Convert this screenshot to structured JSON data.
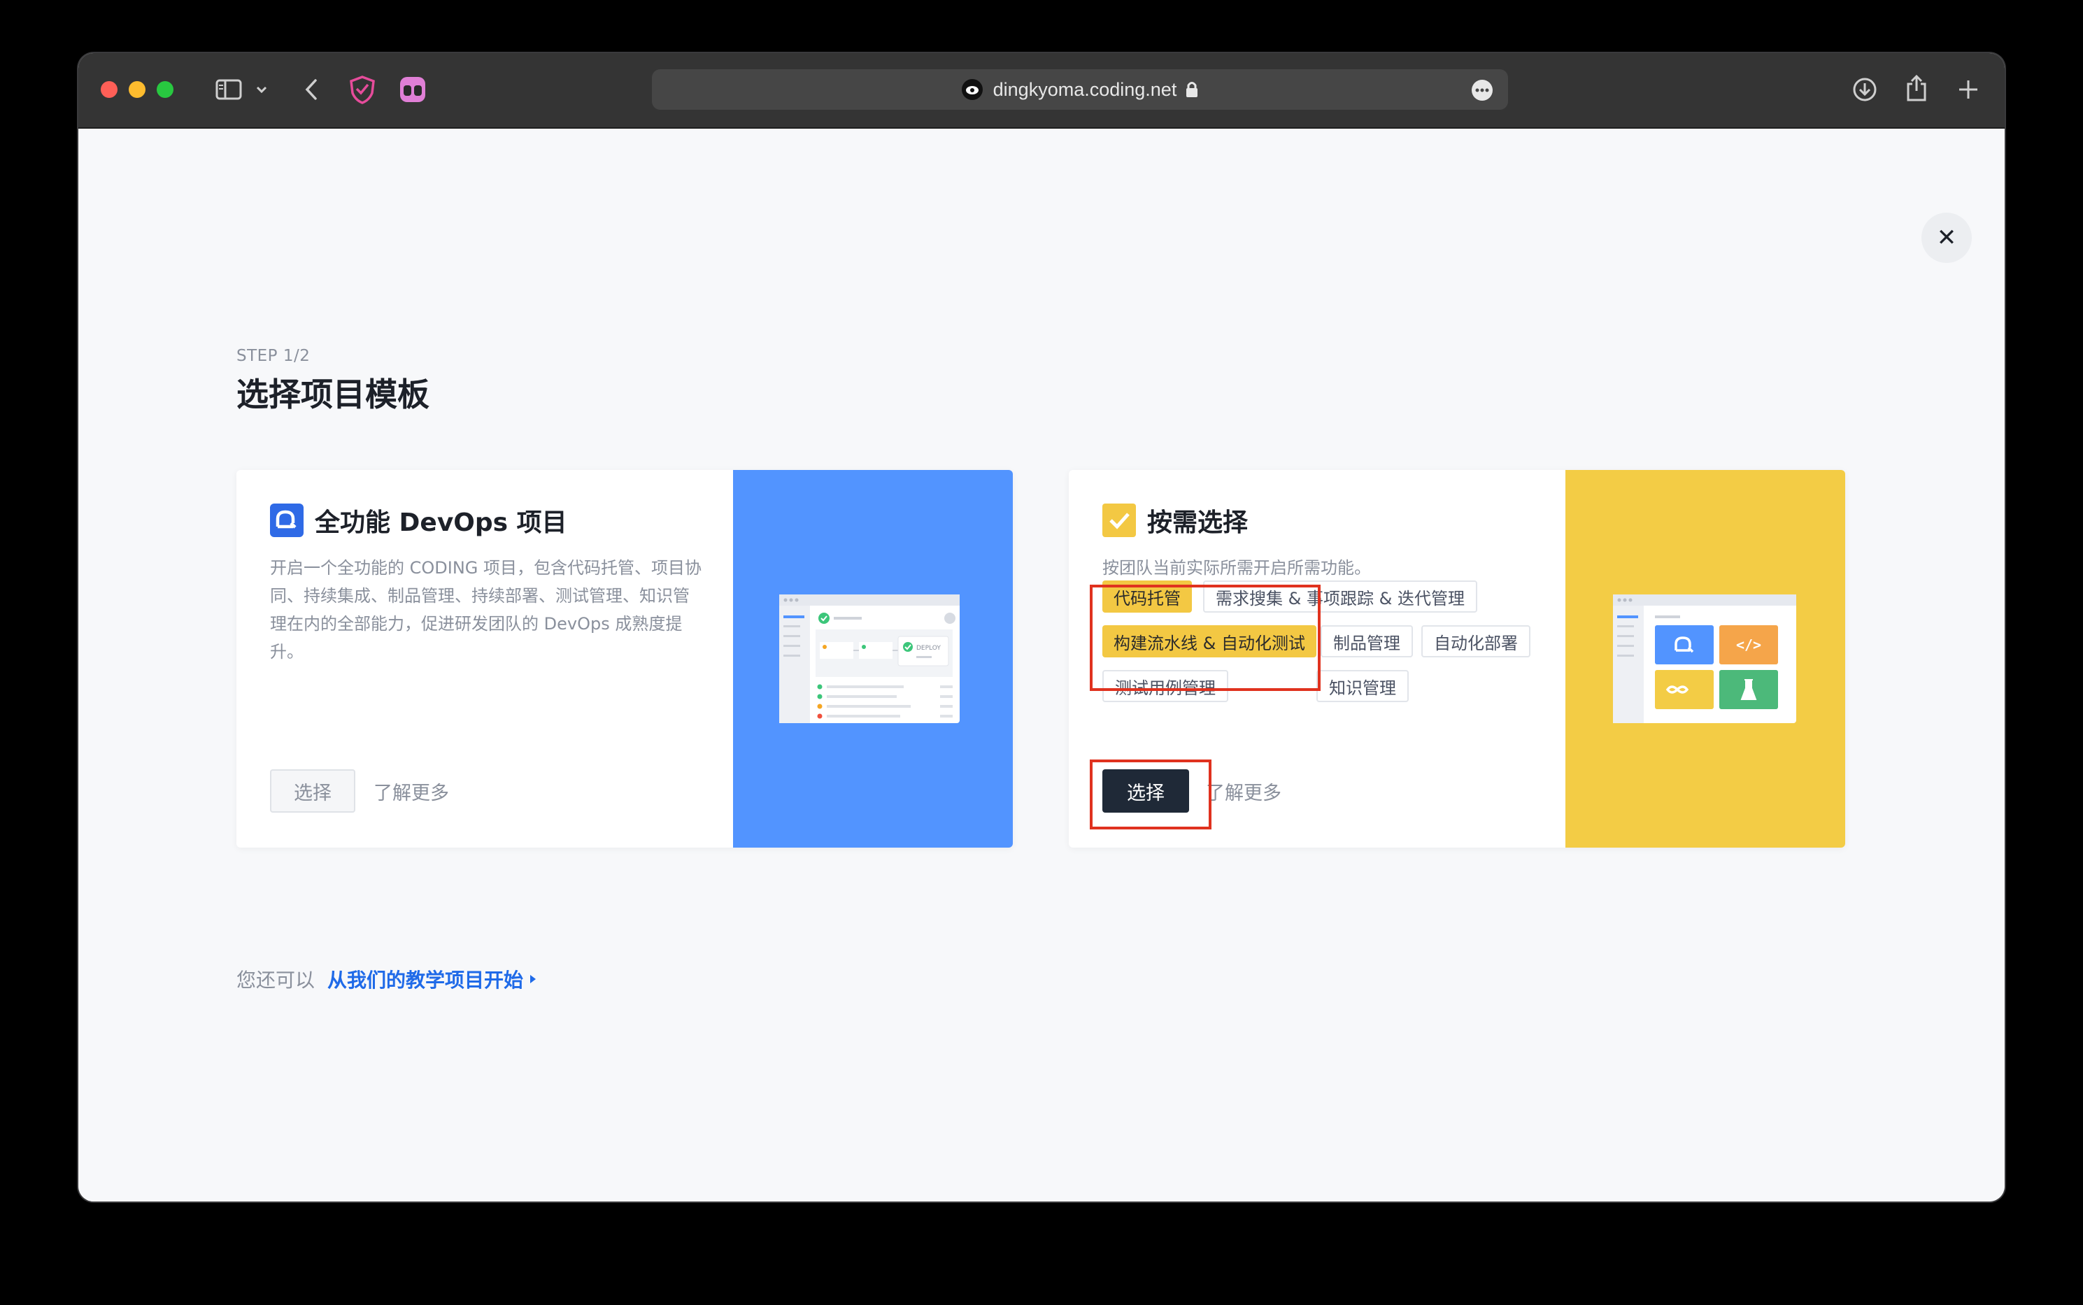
{
  "browser": {
    "url": "dingkyoma.coding.net",
    "icons": [
      "sidebar-icon",
      "chevron-down-icon",
      "back-icon",
      "shield-icon",
      "extension-icon",
      "site-favicon",
      "lock-icon",
      "more-icon",
      "download-icon",
      "share-icon",
      "new-tab-icon"
    ]
  },
  "page": {
    "step": "STEP 1/2",
    "title": "选择项目模板",
    "close_icon": "close-icon"
  },
  "cards": [
    {
      "title": "全功能 DevOps 项目",
      "description": "开启一个全功能的 CODING 项目，包含代码托管、项目协同、持续集成、制品管理、持续部署、测试管理、知识管理在内的全部能力，促进研发团队的 DevOps 成熟度提升。",
      "select_label": "选择",
      "learn_more": "了解更多",
      "illustration": {
        "deploy_label": "DEPLOY"
      },
      "accent": "#5294ff"
    },
    {
      "title": "按需选择",
      "description": "按团队当前实际所需开启所需功能。",
      "tags": [
        {
          "label": "代码托管",
          "selected": true
        },
        {
          "label": "需求搜集 & 事项跟踪 & 迭代管理",
          "selected": false
        },
        {
          "label": "构建流水线 & 自动化测试",
          "selected": true
        },
        {
          "label": "制品管理",
          "selected": false
        },
        {
          "label": "自动化部署",
          "selected": false
        },
        {
          "label": "测试用例管理",
          "selected": false
        },
        {
          "label": "知识管理",
          "selected": false
        }
      ],
      "select_label": "选择",
      "learn_more": "了解更多",
      "accent": "#f3cc45"
    }
  ],
  "footer": {
    "prefix": "您还可以",
    "link": "从我们的教学项目开始"
  }
}
